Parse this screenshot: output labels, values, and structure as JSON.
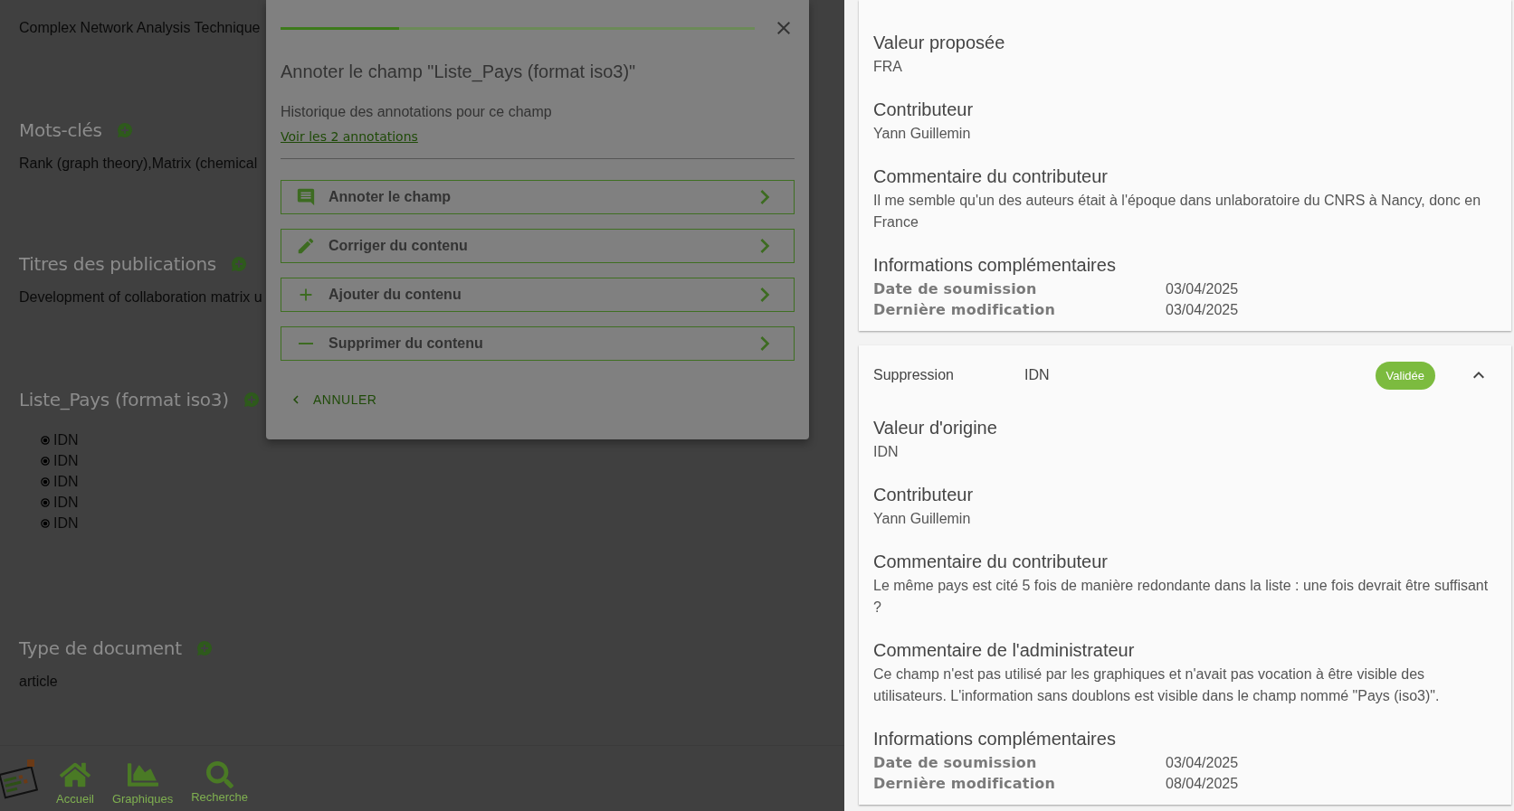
{
  "record": {
    "sections": [
      {
        "kind": "text",
        "value": "Complex Network Analysis Technique"
      },
      {
        "kind": "text",
        "title": "Mots-clés",
        "value": "Rank (graph theory),Matrix (chemical"
      },
      {
        "kind": "text",
        "title": "Titres des publications",
        "value": "Development of collaboration matrix u"
      },
      {
        "kind": "list",
        "title": "Liste_Pays (format iso3)",
        "items": [
          "IDN",
          "IDN",
          "IDN",
          "IDN",
          "IDN"
        ]
      },
      {
        "kind": "text",
        "title": "Type de document",
        "value": "article"
      }
    ]
  },
  "nav": [
    {
      "kind": "home",
      "label": "Accueil"
    },
    {
      "kind": "chart",
      "label": "Graphiques"
    },
    {
      "kind": "search",
      "label": "Recherche"
    }
  ],
  "modal": {
    "progress": {
      "level": 0.25
    },
    "title": "Annoter le champ \"Liste_Pays (format iso3)\"",
    "subtitle": "Historique des annotations pour ce champ",
    "link": "Voir les 2 annotations",
    "actions": [
      {
        "kind": "comment",
        "label": "Annoter le champ"
      },
      {
        "kind": "edit",
        "label": "Corriger du contenu"
      },
      {
        "kind": "add",
        "label": "Ajouter du contenu"
      },
      {
        "kind": "remove",
        "label": "Supprimer du contenu"
      }
    ],
    "cancel": "ANNULER"
  },
  "annotations": [
    {
      "fields": [
        {
          "label": "Valeur proposée",
          "value": "FRA"
        },
        {
          "label": "Contributeur",
          "value": "Yann Guillemin"
        },
        {
          "label": "Commentaire du contributeur",
          "value": "Il me semble qu'un des auteurs était à l'époque dans unlaboratoire du CNRS à Nancy, donc en France"
        }
      ],
      "info": {
        "title": "Informations complémentaires",
        "rows": [
          {
            "label": "Date de soumission",
            "value": "03/04/2025"
          },
          {
            "label": "Dernière modification",
            "value": "03/04/2025"
          }
        ]
      }
    },
    {
      "header": {
        "type": "Suppression",
        "value": "IDN",
        "status": "Validée",
        "expanded": true
      },
      "fields": [
        {
          "label": "Valeur d'origine",
          "value": "IDN"
        },
        {
          "label": "Contributeur",
          "value": "Yann Guillemin"
        },
        {
          "label": "Commentaire du contributeur",
          "value": "Le même pays est cité 5 fois de manière redondante dans la liste : une fois devrait être suffisant ?"
        },
        {
          "label": "Commentaire de l'administrateur",
          "value": "Ce champ n'est pas utilisé par les graphiques et n'avait pas vocation à être visible des utilisateurs. L'information sans doublons est visible dans le champ nommé \"Pays (iso3)\"."
        }
      ],
      "info": {
        "title": "Informations complémentaires",
        "rows": [
          {
            "label": "Date de soumission",
            "value": "03/04/2025"
          },
          {
            "label": "Dernière modification",
            "value": "08/04/2025"
          }
        ]
      }
    }
  ]
}
